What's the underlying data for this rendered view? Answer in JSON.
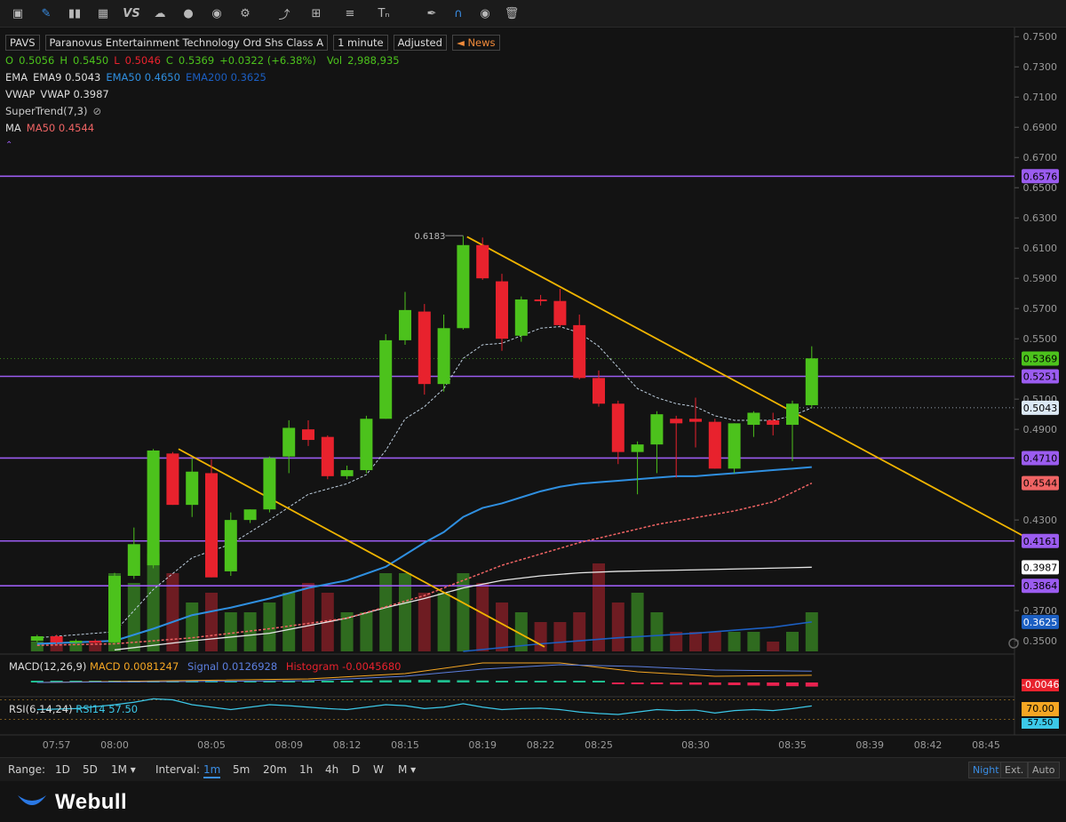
{
  "toolbar": {
    "icons": [
      "chart-type-icon",
      "pencil-icon",
      "bars-icon",
      "grid-icon",
      "vs-icon",
      "cloud-icon",
      "dollar-icon",
      "d-icon",
      "gear-icon",
      "brush-icon",
      "measure-icon",
      "lines-icon",
      "text-icon",
      "pen-icon",
      "magnet-icon",
      "eye-icon",
      "trash-icon"
    ],
    "vs_label": "VS"
  },
  "header": {
    "ticker": "PAVS",
    "name": "Paranovus Entertainment Technology Ord Shs Class A",
    "interval": "1 minute",
    "adjusted": "Adjusted",
    "news": "News"
  },
  "ohlc": {
    "o_label": "O",
    "o": "0.5056",
    "h_label": "H",
    "h": "0.5450",
    "l_label": "L",
    "l": "0.5046",
    "c_label": "C",
    "c": "0.5369",
    "change": "+0.0322 (+6.38%)",
    "vol_label": "Vol",
    "vol": "2,988,935"
  },
  "indicators": {
    "ema_label": "EMA",
    "ema9": "EMA9 0.5043",
    "ema50": "EMA50 0.4650",
    "ema200": "EMA200 0.3625",
    "vwap_label": "VWAP",
    "vwap": "VWAP 0.3987",
    "supertrend": "SuperTrend(7,3)",
    "ma_label": "MA",
    "ma50": "MA50 0.4544"
  },
  "macd": {
    "label": "MACD(12,26,9)",
    "macd": "MACD 0.0081247",
    "signal": "Signal 0.0126928",
    "hist": "Histogram -0.0045680",
    "axis_value": "-0.0046"
  },
  "rsi": {
    "label": "RSI(6,14,24)",
    "rsi14": "RSI14 57.50",
    "axis_value": "70.00",
    "axis_value2": "57.50"
  },
  "range": {
    "label": "Range:",
    "options": [
      "1D",
      "5D",
      "1M ▾"
    ],
    "interval_label": "Interval:",
    "intervals": [
      "1m",
      "5m",
      "20m",
      "1h",
      "4h",
      "D",
      "W",
      "M ▾"
    ],
    "selected_interval": "1m",
    "modes": [
      "Night",
      "Ext.",
      "Auto"
    ]
  },
  "brand": "Webull",
  "colors": {
    "up": "#4cc21c",
    "down": "#e8222d",
    "horizontal": "#9b5cf0",
    "trend": "#f0b400",
    "ema50": "#2f8fe0",
    "ema200": "#1c5fc2",
    "vwap": "#e6e6e6",
    "ma50": "#f06464",
    "ema9": "#bfd0e0"
  },
  "chart_data": {
    "type": "candlestick",
    "yticks": [
      "0.7500",
      "0.7300",
      "0.7100",
      "0.6900",
      "0.6700",
      "0.6500",
      "0.6300",
      "0.6100",
      "0.5900",
      "0.5700",
      "0.5500",
      "0.5100",
      "0.4900",
      "0.4300",
      "0.3700",
      "0.3500"
    ],
    "ylim": [
      0.343,
      0.7525
    ],
    "xticks": [
      [
        "07:57",
        -3
      ],
      [
        "08:00",
        0
      ],
      [
        "08:05",
        5
      ],
      [
        "08:09",
        9
      ],
      [
        "08:12",
        12
      ],
      [
        "08:15",
        15
      ],
      [
        "08:19",
        19
      ],
      [
        "08:22",
        22
      ],
      [
        "08:25",
        25
      ],
      [
        "08:30",
        30
      ],
      [
        "08:35",
        35
      ],
      [
        "08:39",
        39
      ],
      [
        "08:42",
        42
      ],
      [
        "08:45",
        45
      ]
    ],
    "high_marker": "0.6183",
    "candles": [
      [
        -4,
        0.35,
        0.354,
        0.349,
        0.353
      ],
      [
        -3,
        0.353,
        0.354,
        0.348,
        0.349
      ],
      [
        -2,
        0.349,
        0.351,
        0.348,
        0.35
      ],
      [
        -1,
        0.35,
        0.351,
        0.348,
        0.349
      ],
      [
        0,
        0.349,
        0.395,
        0.348,
        0.393
      ],
      [
        1,
        0.393,
        0.425,
        0.391,
        0.414
      ],
      [
        2,
        0.4,
        0.477,
        0.398,
        0.476
      ],
      [
        3,
        0.474,
        0.475,
        0.44,
        0.44
      ],
      [
        4,
        0.44,
        0.471,
        0.432,
        0.462
      ],
      [
        5,
        0.461,
        0.47,
        0.392,
        0.392
      ],
      [
        6,
        0.396,
        0.435,
        0.393,
        0.43
      ],
      [
        7,
        0.43,
        0.437,
        0.428,
        0.437
      ],
      [
        8,
        0.437,
        0.472,
        0.435,
        0.471
      ],
      [
        9,
        0.472,
        0.496,
        0.461,
        0.491
      ],
      [
        10,
        0.49,
        0.496,
        0.479,
        0.483
      ],
      [
        11,
        0.485,
        0.486,
        0.457,
        0.459
      ],
      [
        12,
        0.459,
        0.466,
        0.457,
        0.463
      ],
      [
        13,
        0.463,
        0.499,
        0.461,
        0.497
      ],
      [
        14,
        0.497,
        0.553,
        0.497,
        0.549
      ],
      [
        15,
        0.549,
        0.581,
        0.546,
        0.569
      ],
      [
        16,
        0.568,
        0.573,
        0.513,
        0.52
      ],
      [
        17,
        0.52,
        0.566,
        0.515,
        0.557
      ],
      [
        18,
        0.557,
        0.618,
        0.556,
        0.612
      ],
      [
        19,
        0.612,
        0.617,
        0.589,
        0.59
      ],
      [
        20,
        0.588,
        0.593,
        0.542,
        0.55
      ],
      [
        21,
        0.552,
        0.578,
        0.548,
        0.576
      ],
      [
        22,
        0.576,
        0.579,
        0.572,
        0.575
      ],
      [
        23,
        0.575,
        0.583,
        0.558,
        0.559
      ],
      [
        24,
        0.559,
        0.566,
        0.523,
        0.524
      ],
      [
        25,
        0.524,
        0.529,
        0.505,
        0.507
      ],
      [
        26,
        0.507,
        0.509,
        0.467,
        0.475
      ],
      [
        27,
        0.475,
        0.482,
        0.447,
        0.48
      ],
      [
        28,
        0.48,
        0.502,
        0.461,
        0.5
      ],
      [
        29,
        0.497,
        0.499,
        0.458,
        0.494
      ],
      [
        30,
        0.497,
        0.511,
        0.478,
        0.495
      ],
      [
        31,
        0.495,
        0.497,
        0.464,
        0.464
      ],
      [
        32,
        0.464,
        0.494,
        0.461,
        0.494
      ],
      [
        33,
        0.493,
        0.502,
        0.485,
        0.501
      ],
      [
        34,
        0.496,
        0.501,
        0.486,
        0.493
      ],
      [
        35,
        0.493,
        0.509,
        0.469,
        0.507
      ],
      [
        36,
        0.506,
        0.545,
        0.504,
        0.537
      ]
    ],
    "volume": [
      [
        -4,
        1
      ],
      [
        -3,
        1
      ],
      [
        -2,
        1
      ],
      [
        -1,
        1
      ],
      [
        0,
        8
      ],
      [
        1,
        7
      ],
      [
        2,
        10
      ],
      [
        3,
        8
      ],
      [
        4,
        5
      ],
      [
        5,
        6
      ],
      [
        6,
        4
      ],
      [
        7,
        4
      ],
      [
        8,
        5
      ],
      [
        9,
        6
      ],
      [
        10,
        7
      ],
      [
        11,
        6
      ],
      [
        12,
        4
      ],
      [
        13,
        4
      ],
      [
        14,
        8
      ],
      [
        15,
        8
      ],
      [
        16,
        6
      ],
      [
        17,
        6
      ],
      [
        18,
        8
      ],
      [
        19,
        7
      ],
      [
        20,
        5
      ],
      [
        21,
        4
      ],
      [
        22,
        3
      ],
      [
        23,
        3
      ],
      [
        24,
        4
      ],
      [
        25,
        9
      ],
      [
        26,
        5
      ],
      [
        27,
        6
      ],
      [
        28,
        4
      ],
      [
        29,
        2
      ],
      [
        30,
        2
      ],
      [
        31,
        2
      ],
      [
        32,
        2
      ],
      [
        33,
        2
      ],
      [
        34,
        1
      ],
      [
        35,
        2
      ],
      [
        36,
        4
      ]
    ],
    "horizontal_levels": [
      "0.6576",
      "0.5251",
      "0.4710",
      "0.4161",
      "0.3864"
    ],
    "price_labels": [
      {
        "text": "0.6576",
        "value": 0.6576,
        "bg": "#9b5cf0",
        "fg": "#000000"
      },
      {
        "text": "0.5369",
        "value": 0.5369,
        "bg": "#4cc21c",
        "fg": "#000000"
      },
      {
        "text": "0.5251",
        "value": 0.5251,
        "bg": "#9b5cf0",
        "fg": "#000000"
      },
      {
        "text": "0.5043",
        "value": 0.5043,
        "bg": "#dbe8f5",
        "fg": "#000000"
      },
      {
        "text": "0.4710",
        "value": 0.471,
        "bg": "#9b5cf0",
        "fg": "#000000"
      },
      {
        "text": "0.4544",
        "value": 0.4544,
        "bg": "#f06464",
        "fg": "#000000"
      },
      {
        "text": "0.4161",
        "value": 0.4161,
        "bg": "#9b5cf0",
        "fg": "#000000"
      },
      {
        "text": "0.3987",
        "value": 0.3987,
        "bg": "#ffffff",
        "fg": "#000000"
      },
      {
        "text": "0.3864",
        "value": 0.3864,
        "bg": "#9b5cf0",
        "fg": "#000000"
      },
      {
        "text": "0.3625",
        "value": 0.3625,
        "bg": "#1c5fc2",
        "fg": "#ffffff"
      }
    ],
    "trendlines": [
      {
        "from": [
          3.3,
          0.477
        ],
        "to": [
          22.2,
          0.346
        ]
      },
      {
        "from": [
          18.2,
          0.6175
        ],
        "to": [
          47.5,
          0.4155
        ]
      }
    ],
    "ema9": [
      [
        -4,
        0.352
      ],
      [
        0,
        0.356
      ],
      [
        2,
        0.384
      ],
      [
        4,
        0.405
      ],
      [
        6,
        0.414
      ],
      [
        8,
        0.43
      ],
      [
        10,
        0.447
      ],
      [
        12,
        0.454
      ],
      [
        13,
        0.46
      ],
      [
        14,
        0.476
      ],
      [
        15,
        0.497
      ],
      [
        16,
        0.505
      ],
      [
        17,
        0.517
      ],
      [
        18,
        0.537
      ],
      [
        19,
        0.546
      ],
      [
        20,
        0.547
      ],
      [
        21,
        0.552
      ],
      [
        22,
        0.557
      ],
      [
        23,
        0.558
      ],
      [
        24,
        0.554
      ],
      [
        25,
        0.545
      ],
      [
        26,
        0.531
      ],
      [
        27,
        0.517
      ],
      [
        28,
        0.511
      ],
      [
        29,
        0.507
      ],
      [
        30,
        0.505
      ],
      [
        31,
        0.499
      ],
      [
        32,
        0.496
      ],
      [
        33,
        0.496
      ],
      [
        34,
        0.496
      ],
      [
        35,
        0.499
      ],
      [
        36,
        0.5043
      ]
    ],
    "ema50": [
      [
        -4,
        0.348
      ],
      [
        0,
        0.35
      ],
      [
        2,
        0.358
      ],
      [
        4,
        0.367
      ],
      [
        6,
        0.372
      ],
      [
        8,
        0.378
      ],
      [
        10,
        0.385
      ],
      [
        12,
        0.39
      ],
      [
        14,
        0.399
      ],
      [
        15,
        0.407
      ],
      [
        16,
        0.415
      ],
      [
        17,
        0.422
      ],
      [
        18,
        0.432
      ],
      [
        19,
        0.438
      ],
      [
        20,
        0.441
      ],
      [
        21,
        0.445
      ],
      [
        22,
        0.449
      ],
      [
        23,
        0.452
      ],
      [
        24,
        0.454
      ],
      [
        25,
        0.455
      ],
      [
        26,
        0.456
      ],
      [
        27,
        0.457
      ],
      [
        28,
        0.458
      ],
      [
        29,
        0.459
      ],
      [
        30,
        0.459
      ],
      [
        31,
        0.46
      ],
      [
        32,
        0.461
      ],
      [
        33,
        0.462
      ],
      [
        34,
        0.463
      ],
      [
        35,
        0.464
      ],
      [
        36,
        0.465
      ]
    ],
    "ma50": [
      [
        -4,
        0.347
      ],
      [
        0,
        0.348
      ],
      [
        4,
        0.352
      ],
      [
        8,
        0.358
      ],
      [
        12,
        0.365
      ],
      [
        16,
        0.38
      ],
      [
        20,
        0.4
      ],
      [
        24,
        0.415
      ],
      [
        28,
        0.427
      ],
      [
        32,
        0.436
      ],
      [
        34,
        0.442
      ],
      [
        36,
        0.4544
      ]
    ],
    "vwap": [
      [
        0,
        0.344
      ],
      [
        4,
        0.35
      ],
      [
        8,
        0.355
      ],
      [
        10,
        0.36
      ],
      [
        12,
        0.365
      ],
      [
        14,
        0.372
      ],
      [
        16,
        0.378
      ],
      [
        18,
        0.385
      ],
      [
        20,
        0.39
      ],
      [
        22,
        0.393
      ],
      [
        24,
        0.395
      ],
      [
        26,
        0.396
      ],
      [
        30,
        0.397
      ],
      [
        36,
        0.3987
      ]
    ],
    "ema200": [
      [
        18,
        0.343
      ],
      [
        22,
        0.348
      ],
      [
        26,
        0.352
      ],
      [
        30,
        0.355
      ],
      [
        34,
        0.359
      ],
      [
        36,
        0.3625
      ]
    ],
    "macd_series": {
      "macd": [
        [
          -4,
          0
        ],
        [
          10,
          0.004
        ],
        [
          15,
          0.01
        ],
        [
          19,
          0.022
        ],
        [
          23,
          0.022
        ],
        [
          27,
          0.012
        ],
        [
          31,
          0.007
        ],
        [
          36,
          0.0081
        ]
      ],
      "signal": [
        [
          -4,
          0
        ],
        [
          10,
          0.002
        ],
        [
          15,
          0.007
        ],
        [
          19,
          0.015
        ],
        [
          23,
          0.02
        ],
        [
          27,
          0.018
        ],
        [
          31,
          0.014
        ],
        [
          36,
          0.0127
        ]
      ],
      "hist": [
        [
          -4,
          0
        ],
        [
          0,
          0.001
        ],
        [
          4,
          0.002
        ],
        [
          8,
          0.002
        ],
        [
          12,
          0.002
        ],
        [
          16,
          0.003
        ],
        [
          20,
          0.002
        ],
        [
          24,
          0.001
        ],
        [
          28,
          -0.002
        ],
        [
          32,
          -0.003
        ],
        [
          36,
          -0.0046
        ]
      ]
    },
    "rsi_series": [
      [
        -4,
        50
      ],
      [
        -2,
        52
      ],
      [
        0,
        60
      ],
      [
        1,
        65
      ],
      [
        2,
        72
      ],
      [
        3,
        70
      ],
      [
        4,
        60
      ],
      [
        5,
        55
      ],
      [
        6,
        50
      ],
      [
        7,
        55
      ],
      [
        8,
        60
      ],
      [
        9,
        58
      ],
      [
        10,
        55
      ],
      [
        11,
        52
      ],
      [
        12,
        50
      ],
      [
        13,
        55
      ],
      [
        14,
        60
      ],
      [
        15,
        58
      ],
      [
        16,
        52
      ],
      [
        17,
        55
      ],
      [
        18,
        62
      ],
      [
        19,
        55
      ],
      [
        20,
        50
      ],
      [
        21,
        52
      ],
      [
        22,
        53
      ],
      [
        23,
        50
      ],
      [
        24,
        45
      ],
      [
        25,
        42
      ],
      [
        26,
        40
      ],
      [
        27,
        45
      ],
      [
        28,
        50
      ],
      [
        29,
        48
      ],
      [
        30,
        49
      ],
      [
        31,
        43
      ],
      [
        32,
        48
      ],
      [
        33,
        50
      ],
      [
        34,
        48
      ],
      [
        35,
        52
      ],
      [
        36,
        57.5
      ]
    ]
  }
}
